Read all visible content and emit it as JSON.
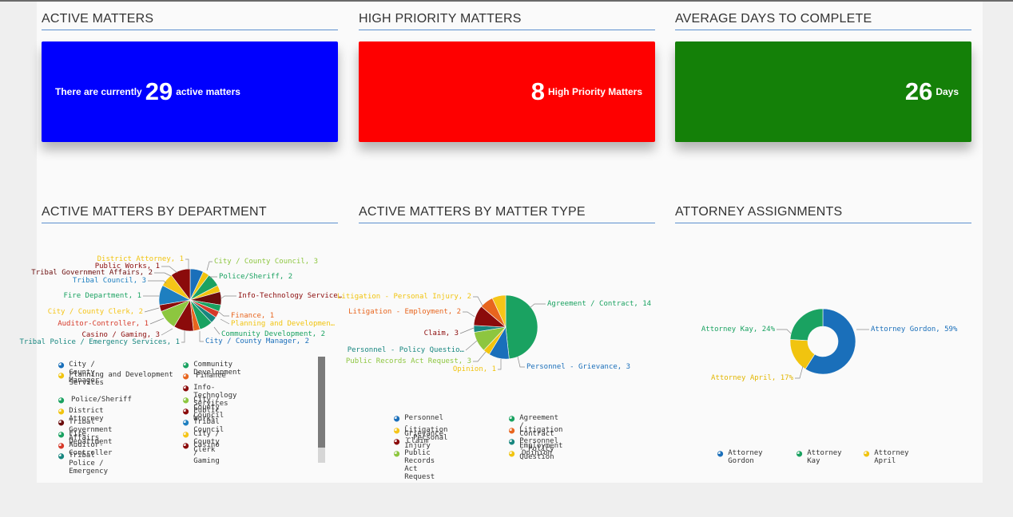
{
  "kpi": {
    "active": {
      "title": "ACTIVE MATTERS",
      "prefix": "There are currently",
      "value": "29",
      "suffix": "active matters",
      "color": "#0000fe"
    },
    "high": {
      "title": "HIGH PRIORITY MATTERS",
      "value": "8",
      "suffix": "High Priority Matters",
      "color": "#fe0000"
    },
    "avg": {
      "title": "AVERAGE DAYS TO COMPLETE",
      "value": "26",
      "suffix": "Days",
      "color": "#148008"
    }
  },
  "sections": {
    "dept": "ACTIVE MATTERS BY DEPARTMENT",
    "type": "ACTIVE MATTERS BY MATTER TYPE",
    "attorney": "ATTORNEY ASSIGNMENTS"
  },
  "chart_data": [
    {
      "type": "pie",
      "title": "ACTIVE MATTERS BY DEPARTMENT",
      "categories": [
        "City / County Manager",
        "Planning and Development Services",
        "Police/Sheriff",
        "District Attorney",
        "Tribal Government Affairs",
        "Fire Department",
        "Auditor-Controller",
        "Tribal Police / Emergency Services",
        "Community Development",
        "Finance",
        "Info-Technology Services",
        "City / County Council",
        "Public Works",
        "Tribal Council",
        "City / County Clerk",
        "Casino / Gaming"
      ],
      "values": [
        2,
        1,
        2,
        1,
        2,
        1,
        1,
        1,
        2,
        1,
        3,
        3,
        1,
        3,
        2,
        3
      ],
      "colors": [
        "#1a6fba",
        "#f1c40f",
        "#1aa261",
        "#f1c40f",
        "#6b0c0c",
        "#1aa261",
        "#d63a2a",
        "#17867f",
        "#1aa261",
        "#e8651e",
        "#8b0b0b",
        "#8dc63f",
        "#8b0b0b",
        "#1e7fc0",
        "#f5c518",
        "#8b0b0b"
      ],
      "data_labels": [
        {
          "text": "District Attorney, 1",
          "color": "#f1c40f"
        },
        {
          "text": "Public Works, 1",
          "color": "#8b0b0b"
        },
        {
          "text": "Tribal Government Affairs, 2",
          "color": "#6b0c0c"
        },
        {
          "text": "Tribal Council, 3",
          "color": "#1e7fc0"
        },
        {
          "text": "Fire Department, 1",
          "color": "#1aa261"
        },
        {
          "text": "City / County Clerk, 2",
          "color": "#f5c518"
        },
        {
          "text": "Auditor-Controller, 1",
          "color": "#d63a2a"
        },
        {
          "text": "Casino / Gaming, 3",
          "color": "#8b0b0b"
        },
        {
          "text": "Tribal Police / Emergency Services, 1",
          "color": "#17867f"
        },
        {
          "text": "City / County Council, 3",
          "color": "#8dc63f"
        },
        {
          "text": "Police/Sheriff, 2",
          "color": "#1aa261"
        },
        {
          "text": "Info-Technology Service…",
          "color": "#8b0b0b"
        },
        {
          "text": "Finance, 1",
          "color": "#e8651e"
        },
        {
          "text": "Planning and Developmen…",
          "color": "#f1c40f"
        },
        {
          "text": "Community Development, 2",
          "color": "#1aa261"
        },
        {
          "text": "City / County Manager, 2",
          "color": "#1a6fba"
        }
      ],
      "legend": [
        {
          "text": "City / County Manager",
          "color": "#1a6fba"
        },
        {
          "text": "Community Development",
          "color": "#1aa261"
        },
        {
          "text": "Planning and Development Services",
          "color": "#f1c40f"
        },
        {
          "text": "Finance",
          "color": "#e8651e"
        },
        {
          "text": "Info-Technology Services",
          "color": "#8b0b0b"
        },
        {
          "text": "Police/Sheriff",
          "color": "#1aa261"
        },
        {
          "text": "City / County Council",
          "color": "#8dc63f"
        },
        {
          "text": "District Attorney",
          "color": "#f1c40f"
        },
        {
          "text": "Public Works",
          "color": "#8b0b0b"
        },
        {
          "text": "Tribal Government Affairs",
          "color": "#6b0c0c"
        },
        {
          "text": "Tribal Council",
          "color": "#1e7fc0"
        },
        {
          "text": "Fire Department",
          "color": "#1aa261"
        },
        {
          "text": "City / County Clerk",
          "color": "#f5c518"
        },
        {
          "text": "Auditor-Controller",
          "color": "#d63a2a"
        },
        {
          "text": "Casino / Gaming",
          "color": "#8b0b0b"
        },
        {
          "text": "Tribal Police / Emergency",
          "color": "#17867f"
        }
      ]
    },
    {
      "type": "pie",
      "title": "ACTIVE MATTERS BY MATTER TYPE",
      "categories": [
        "Agreement / Contract",
        "Personnel - Grievance",
        "Opinion",
        "Public Records Act Request",
        "Personnel - Policy Question",
        "Claim",
        "Litigation - Employment",
        "Litigation - Personal Injury"
      ],
      "values": [
        14,
        3,
        1,
        3,
        1,
        3,
        2,
        2
      ],
      "colors": [
        "#1aa261",
        "#1a6fba",
        "#f1c40f",
        "#8dc63f",
        "#17867f",
        "#8b0b0b",
        "#e8651e",
        "#f5c518"
      ],
      "data_labels": [
        {
          "text": "Litigation - Personal Injury, 2",
          "color": "#f1c40f"
        },
        {
          "text": "Litigation - Employment, 2",
          "color": "#e8651e"
        },
        {
          "text": "Claim, 3",
          "color": "#8b0b0b"
        },
        {
          "text": "Personnel - Policy Questio…",
          "color": "#17867f"
        },
        {
          "text": "Public Records Act Request, 3",
          "color": "#8dc63f"
        },
        {
          "text": "Opinion, 1",
          "color": "#f1c40f"
        },
        {
          "text": "Agreement / Contract, 14",
          "color": "#1aa261"
        },
        {
          "text": "Personnel - Grievance, 3",
          "color": "#1a6fba"
        }
      ],
      "legend": [
        {
          "text": "Personnel - Grievance",
          "color": "#1a6fba"
        },
        {
          "text": "Agreement / Contract",
          "color": "#1aa261"
        },
        {
          "text": "Litigation - Personal Injury",
          "color": "#f5c518"
        },
        {
          "text": "Litigation - Employment",
          "color": "#e8651e"
        },
        {
          "text": "Claim",
          "color": "#8b0b0b"
        },
        {
          "text": "Personnel - Policy Question",
          "color": "#17867f"
        },
        {
          "text": "Public Records Act Request",
          "color": "#8dc63f"
        },
        {
          "text": "Opinion",
          "color": "#f1c40f"
        }
      ]
    },
    {
      "type": "pie",
      "title": "ATTORNEY ASSIGNMENTS",
      "donut": true,
      "categories": [
        "Attorney Gordon",
        "Attorney April",
        "Attorney Kay"
      ],
      "values": [
        59,
        17,
        24
      ],
      "colors": [
        "#1a6fba",
        "#f1c40f",
        "#1aa261"
      ],
      "data_labels": [
        {
          "text": "Attorney Kay, 24%",
          "color": "#1aa261"
        },
        {
          "text": "Attorney Gordon, 59%",
          "color": "#1a6fba"
        },
        {
          "text": "Attorney April, 17%",
          "color": "#e2b600"
        }
      ],
      "legend": [
        {
          "text": "Attorney Gordon",
          "color": "#1a6fba"
        },
        {
          "text": "Attorney Kay",
          "color": "#1aa261"
        },
        {
          "text": "Attorney April",
          "color": "#f1c40f"
        }
      ]
    }
  ]
}
